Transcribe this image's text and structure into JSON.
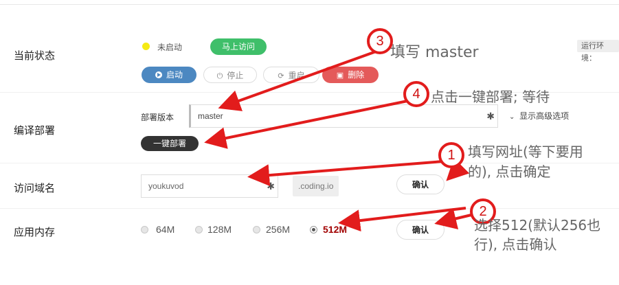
{
  "rows": {
    "status": {
      "label": "当前状态",
      "status_text": "未启动",
      "visit_button": "马上访问",
      "env_label": "运行环境：",
      "start_button": "启动",
      "stop_button": "停止",
      "restart_button": "重启",
      "delete_button": "删除"
    },
    "deploy": {
      "label": "编译部署",
      "version_label": "部署版本",
      "version_value": "master",
      "advanced": "显示高级选项",
      "deploy_button": "一键部署"
    },
    "domain": {
      "label": "访问域名",
      "value": "youkuvod",
      "suffix": ".coding.io",
      "confirm_button": "确认"
    },
    "memory": {
      "label": "应用内存",
      "options": [
        "64M",
        "128M",
        "256M",
        "512M"
      ],
      "selected": "512M",
      "confirm_button": "确认"
    }
  },
  "annotations": {
    "a1": {
      "num": "1",
      "line1": "填写网址(等下要用",
      "line2": "的), 点击确定"
    },
    "a2": {
      "num": "2",
      "line1": "选择512(默认256也",
      "line2": "行), 点击确认"
    },
    "a3": {
      "num": "3",
      "text": "填写 master"
    },
    "a4": {
      "num": "4",
      "text": "点击一键部署; 等待"
    }
  },
  "colors": {
    "accent_green": "#3fbf6a",
    "accent_blue": "#4c88c1",
    "accent_red": "#e45a5a",
    "annotation_red": "#e21c1c"
  }
}
